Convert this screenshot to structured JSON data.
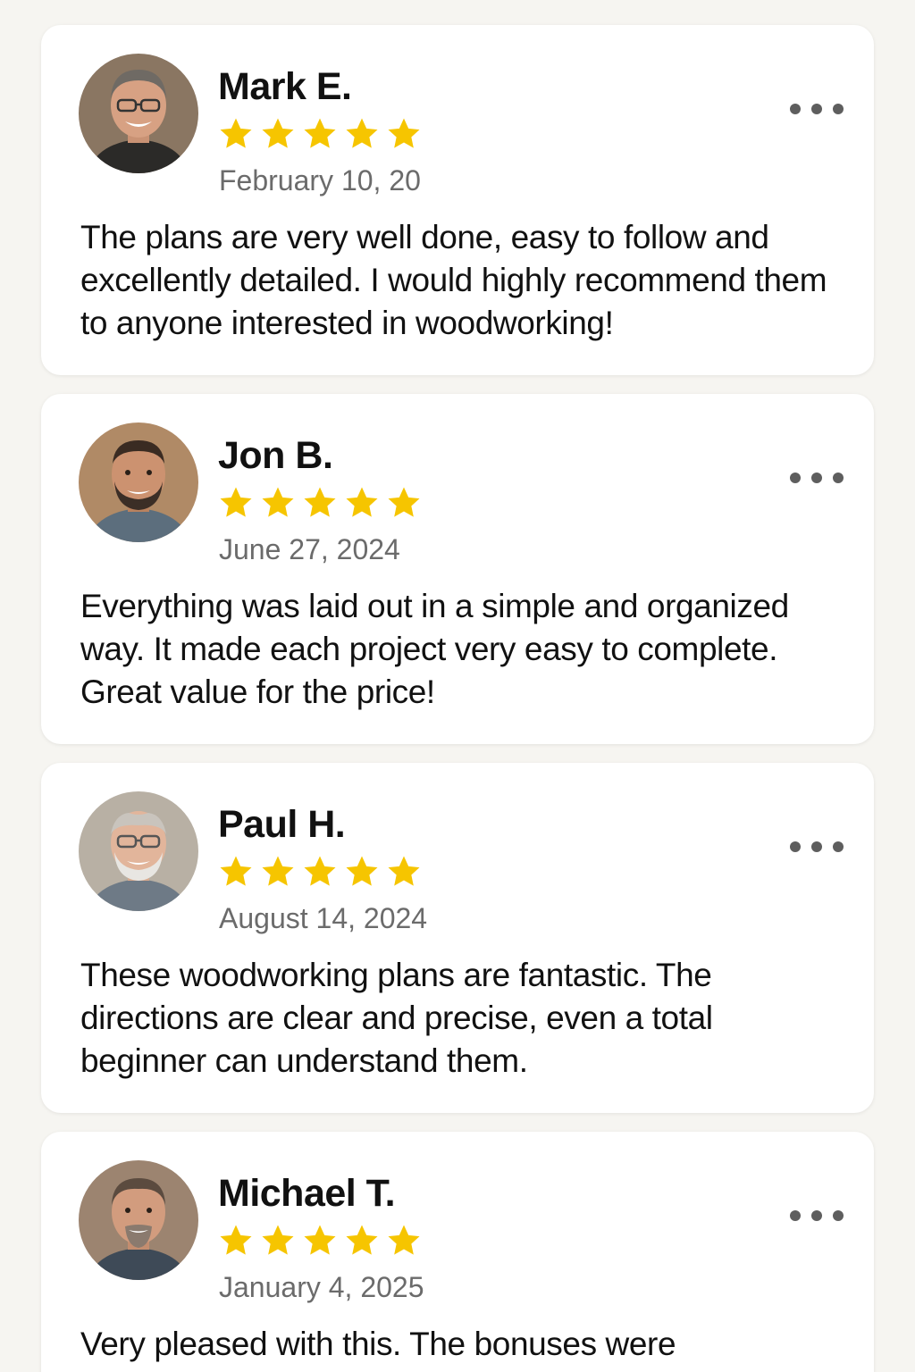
{
  "colors": {
    "background": "#f6f5f1",
    "card": "#ffffff",
    "star": "#f6c500",
    "date": "#6b6b6b",
    "menu_dots": "#5e5e5e"
  },
  "reviews": [
    {
      "name": "Mark E.",
      "rating": 5,
      "date": "February 10, 20",
      "text": "The plans are very well done, easy to follow and excellently detailed. I would highly recommend them to anyone interested in woodworking!",
      "avatar_icon": "avatar-photo-man-glasses"
    },
    {
      "name": "Jon B.",
      "rating": 5,
      "date": "June 27, 2024",
      "text": "Everything was laid out in a simple and organized way. It made each project very easy to complete. Great value for the price!",
      "avatar_icon": "avatar-photo-man-beard"
    },
    {
      "name": "Paul H.",
      "rating": 5,
      "date": "August 14, 2024",
      "text": "These woodworking plans are fantastic. The directions are clear and precise, even a total beginner can understand them.",
      "avatar_icon": "avatar-photo-older-man-glasses"
    },
    {
      "name": "Michael T.",
      "rating": 5,
      "date": "January 4, 2025",
      "text": "Very pleased with this. The bonuses were",
      "avatar_icon": "avatar-photo-man-goatee"
    }
  ]
}
